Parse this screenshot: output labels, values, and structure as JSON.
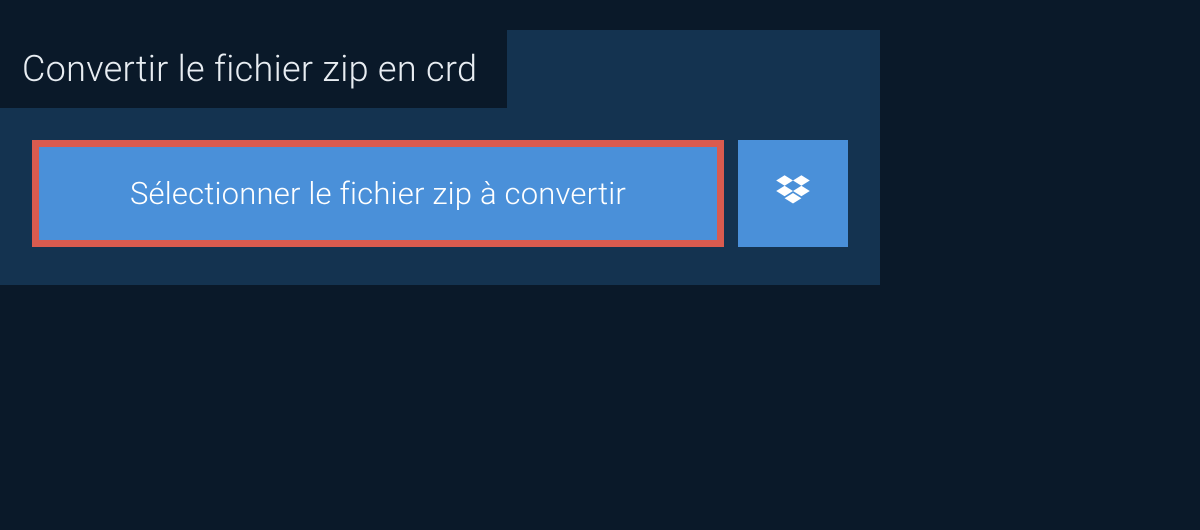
{
  "header": {
    "title": "Convertir le fichier zip en crd"
  },
  "actions": {
    "select_file_label": "Sélectionner le fichier zip à convertir",
    "dropbox_icon_name": "dropbox-icon"
  },
  "colors": {
    "background_dark": "#0a1929",
    "panel": "#143350",
    "button_primary": "#4a90d9",
    "button_highlight_border": "#d95b4f",
    "text_light": "#e8edf2"
  }
}
